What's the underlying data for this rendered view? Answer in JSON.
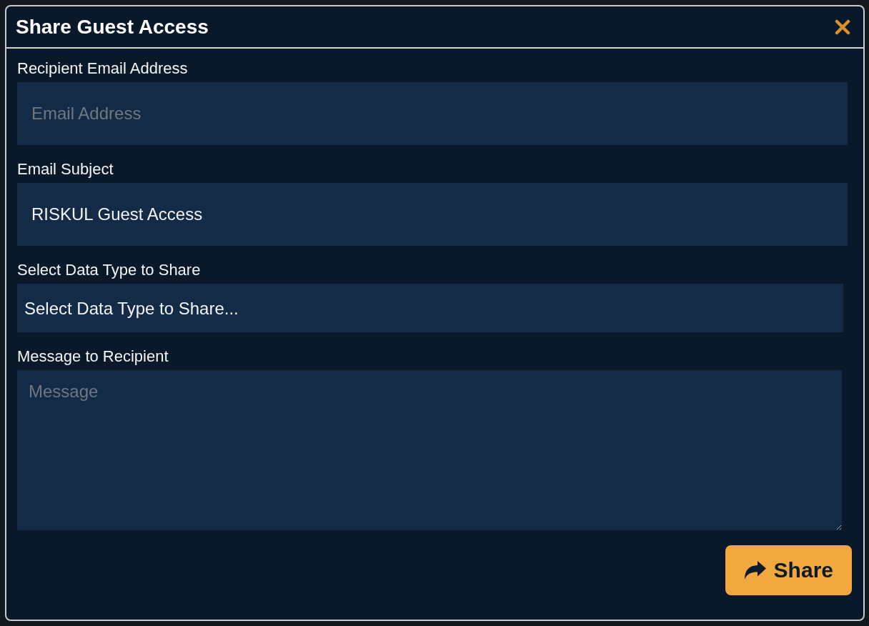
{
  "dialog": {
    "title": "Share Guest Access"
  },
  "fields": [
    {
      "kind": "input",
      "label": "Recipient Email Address",
      "placeholder": "Email Address"
    },
    {
      "kind": "input",
      "label": "Email Subject",
      "value": "RISKUL Guest Access"
    },
    {
      "kind": "select",
      "label": "Select Data Type to Share",
      "value": "Select Data Type to Share..."
    },
    {
      "kind": "textarea",
      "label": "Message to Recipient",
      "placeholder": "Message"
    }
  ],
  "buttons": [
    {
      "kind": "share",
      "label": "Share"
    }
  ]
}
